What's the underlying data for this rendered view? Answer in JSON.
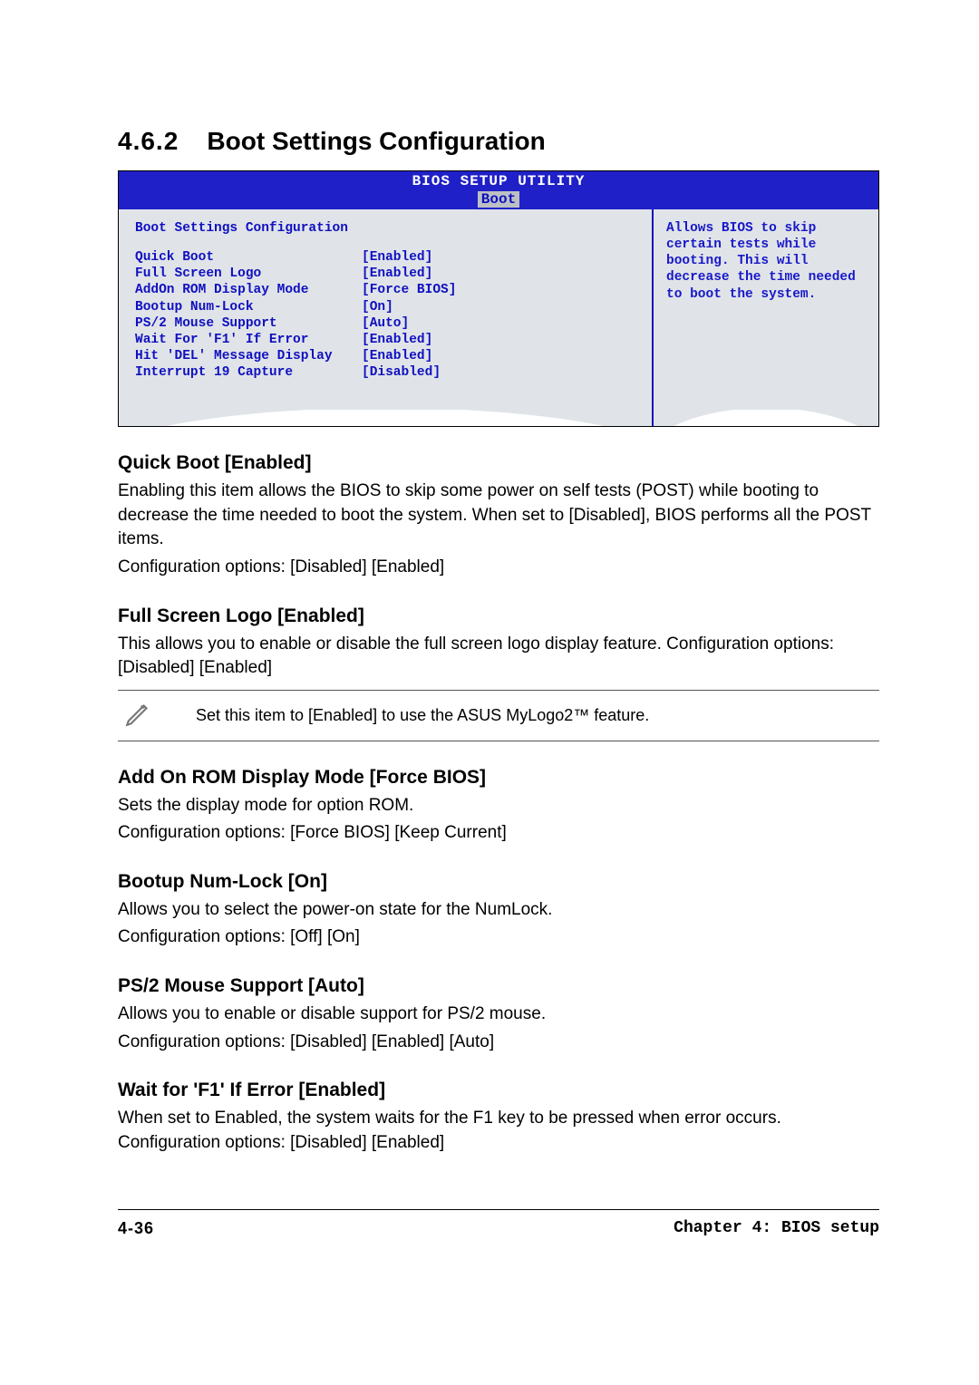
{
  "heading": {
    "number": "4.6.2",
    "title": "Boot Settings Configuration"
  },
  "bios": {
    "utility_title": "BIOS SETUP UTILITY",
    "tab": "Boot",
    "config_title": "Boot Settings Configuration",
    "rows": [
      {
        "label": "Quick Boot",
        "value": "[Enabled]"
      },
      {
        "label": "Full Screen Logo",
        "value": "[Enabled]"
      },
      {
        "label": "AddOn ROM Display Mode",
        "value": "[Force BIOS]"
      },
      {
        "label": "Bootup Num-Lock",
        "value": "[On]"
      },
      {
        "label": "PS/2 Mouse Support",
        "value": "[Auto]"
      },
      {
        "label": "Wait For 'F1' If Error",
        "value": "[Enabled]"
      },
      {
        "label": "Hit 'DEL' Message Display",
        "value": "[Enabled]"
      },
      {
        "label": "Interrupt 19 Capture",
        "value": "[Disabled]"
      }
    ],
    "help": "Allows BIOS to skip certain tests while booting. This will decrease the time needed to boot the system."
  },
  "options": [
    {
      "heading": "Quick Boot [Enabled]",
      "body": "Enabling this item allows the BIOS to skip some power on self tests (POST) while booting to decrease the time needed to boot the system. When set to [Disabled], BIOS performs all the POST items.\nConfiguration options: [Disabled] [Enabled]"
    },
    {
      "heading": "Full Screen Logo [Enabled]",
      "body": "This allows you to enable or disable the full screen logo display feature. Configuration options: [Disabled] [Enabled]",
      "note": "Set this item to [Enabled] to use the ASUS MyLogo2™ feature."
    },
    {
      "heading": "Add On ROM Display Mode [Force BIOS]",
      "body": "Sets the display mode for option ROM.\nConfiguration options: [Force BIOS] [Keep Current]"
    },
    {
      "heading": "Bootup Num-Lock [On]",
      "body": "Allows you to select the power-on state for the NumLock.\nConfiguration options: [Off] [On]"
    },
    {
      "heading": "PS/2 Mouse Support [Auto]",
      "body": "Allows you to enable or disable support for PS/2 mouse.\nConfiguration options: [Disabled] [Enabled] [Auto]"
    },
    {
      "heading": "Wait for 'F1' If Error [Enabled]",
      "body": "When set to Enabled, the system waits for the F1 key to be pressed when error occurs. Configuration options: [Disabled] [Enabled]"
    }
  ],
  "footer": {
    "page": "4-36",
    "chapter": "Chapter 4: BIOS setup"
  }
}
